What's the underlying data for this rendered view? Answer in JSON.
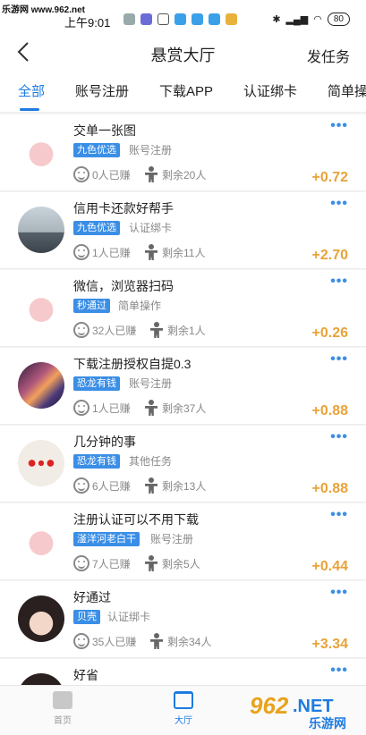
{
  "statusbar": {
    "watermark": "乐游网 www.962.net",
    "time": "上午9:01",
    "battery": "80"
  },
  "header": {
    "back_icon": "chevron-left-icon",
    "title": "悬赏大厅",
    "post_task": "发任务"
  },
  "tabs": [
    {
      "label": "全部",
      "active": true
    },
    {
      "label": "账号注册",
      "active": false
    },
    {
      "label": "下载APP",
      "active": false
    },
    {
      "label": "认证绑卡",
      "active": false
    },
    {
      "label": "简单操",
      "active": false
    }
  ],
  "tasks": [
    {
      "title": "交单一张图",
      "tag": "九色优选",
      "category": "账号注册",
      "earned": "0人已赚",
      "remaining": "剩余20人",
      "reward": "+0.72",
      "avatar": "pink-pig"
    },
    {
      "title": "信用卡还款好帮手",
      "tag": "九色优选",
      "category": "认证绑卡",
      "earned": "1人已赚",
      "remaining": "剩余11人",
      "reward": "+2.70",
      "avatar": "grey-landscape"
    },
    {
      "title": "微信，浏览器扫码",
      "tag": "秒通过",
      "category": "简单操作",
      "earned": "32人已赚",
      "remaining": "剩余1人",
      "reward": "+0.26",
      "avatar": "pink-pig"
    },
    {
      "title": "下载注册授权自提0.3",
      "tag": "恐龙有钱",
      "category": "账号注册",
      "earned": "1人已赚",
      "remaining": "剩余37人",
      "reward": "+0.88",
      "avatar": "rainbow"
    },
    {
      "title": "几分钟的事",
      "tag": "恐龙有钱",
      "category": "其他任务",
      "earned": "6人已赚",
      "remaining": "剩余13人",
      "reward": "+0.88",
      "avatar": "hearts"
    },
    {
      "title": "注册认证可以不用下载",
      "tag": "滏洋河老白干",
      "category": "账号注册",
      "earned": "7人已赚",
      "remaining": "剩余5人",
      "reward": "+0.44",
      "avatar": "pink-pig"
    },
    {
      "title": "好通过",
      "tag": "贝壳",
      "category": "认证绑卡",
      "earned": "35人已赚",
      "remaining": "剩余34人",
      "reward": "+3.34",
      "avatar": "child"
    },
    {
      "title": "好省",
      "tag": "",
      "category": "",
      "earned": "",
      "remaining": "",
      "reward": "",
      "avatar": "child"
    }
  ],
  "bottom_nav": [
    {
      "label": "首页",
      "icon": "home-icon",
      "active": false
    },
    {
      "label": "大厅",
      "icon": "hall-icon",
      "active": true
    }
  ],
  "watermark": {
    "text1": "962",
    "text2": ".NET",
    "text3": "乐游网"
  },
  "colors": {
    "accent": "#1e7be0",
    "tag": "#3a8ee6",
    "reward": "#e8a33a"
  }
}
